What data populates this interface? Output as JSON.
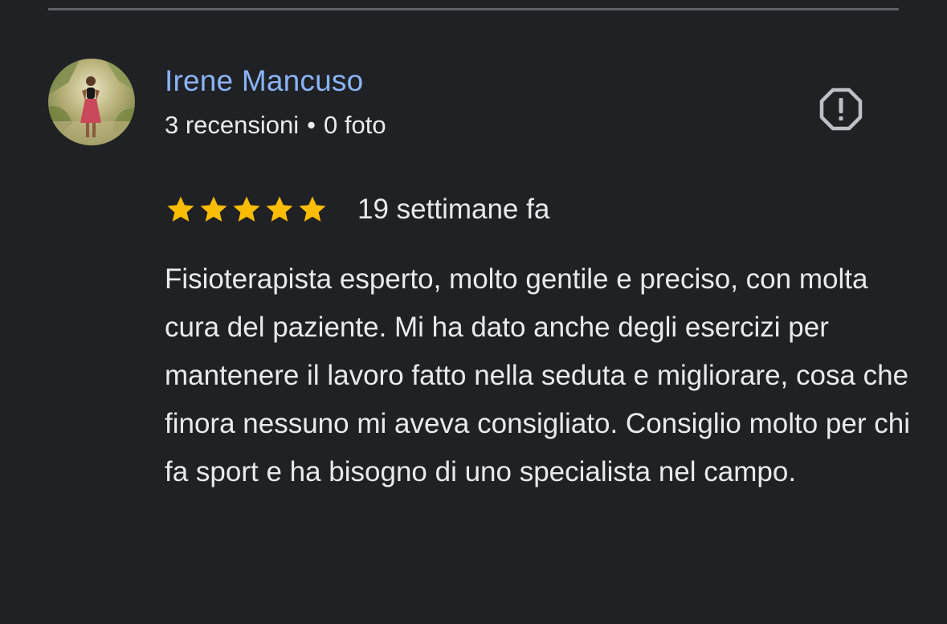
{
  "review": {
    "reviewer_name": "Irene Mancuso",
    "review_count": "3 recensioni",
    "meta_separator": "•",
    "photo_count": "0 foto",
    "rating": 5,
    "rating_max": 5,
    "date": "19 settimane fa",
    "text": "Fisioterapista esperto, molto gentile e preciso, con molta cura del paziente. Mi ha dato anche degli esercizi per mantenere il lavoro fatto nella seduta e migliorare, cosa che finora nessuno mi aveva consigliato. Consiglio molto per chi fa sport e ha bisogno di uno specialista nel campo."
  },
  "icons": {
    "report": "report-octagon-icon",
    "star": "star-icon"
  },
  "colors": {
    "background": "#202124",
    "name_link": "#8ab4f8",
    "text": "#e8eaed",
    "star": "#fbbc04",
    "divider": "#5f6368",
    "report_icon": "#bdc1c6"
  }
}
